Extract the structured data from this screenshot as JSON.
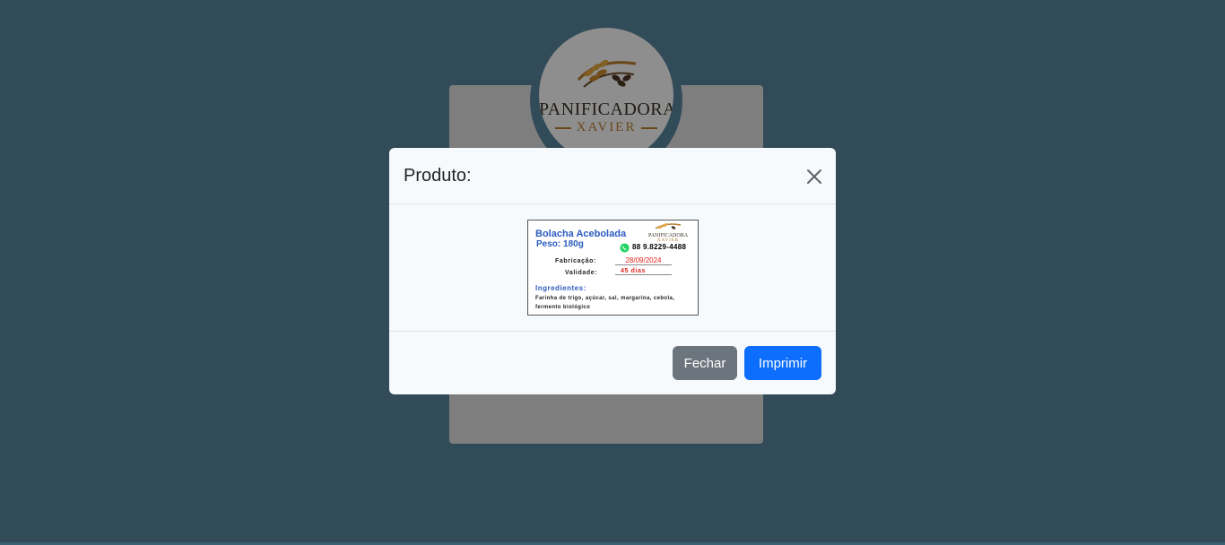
{
  "background": {
    "brand_logo": {
      "name": "PANIFICADORA",
      "sub": "XAVIER",
      "icon": "wheat-icon"
    }
  },
  "modal": {
    "title": "Produto:",
    "close_icon": "close-icon",
    "label": {
      "product_name": "Bolacha Acebolada",
      "weight": "Peso: 180g",
      "logo_name": "PANIFICADORA",
      "logo_sub": "XAVIER",
      "whatsapp_icon": "whatsapp-icon",
      "phone": "88 9.8229-4488",
      "fabrication_label": "Fabricação:",
      "fabrication_date": "28/09/2024",
      "validity_label": "Validade:",
      "validity_value": "45 dias",
      "ingredients_title": "Ingredientes:",
      "ingredients_text": "Farinha de trigo, açúcar, sal, margarina, cebola, fermento biológico"
    },
    "buttons": {
      "close_label": "Fechar",
      "print_label": "Imprimir"
    }
  },
  "colors": {
    "page_background": "#57829a",
    "primary": "#0d6efd",
    "secondary": "#6c757d",
    "label_blue": "#2b5bc0",
    "label_red": "#e0241d",
    "brand_gold": "#b57a2b"
  }
}
